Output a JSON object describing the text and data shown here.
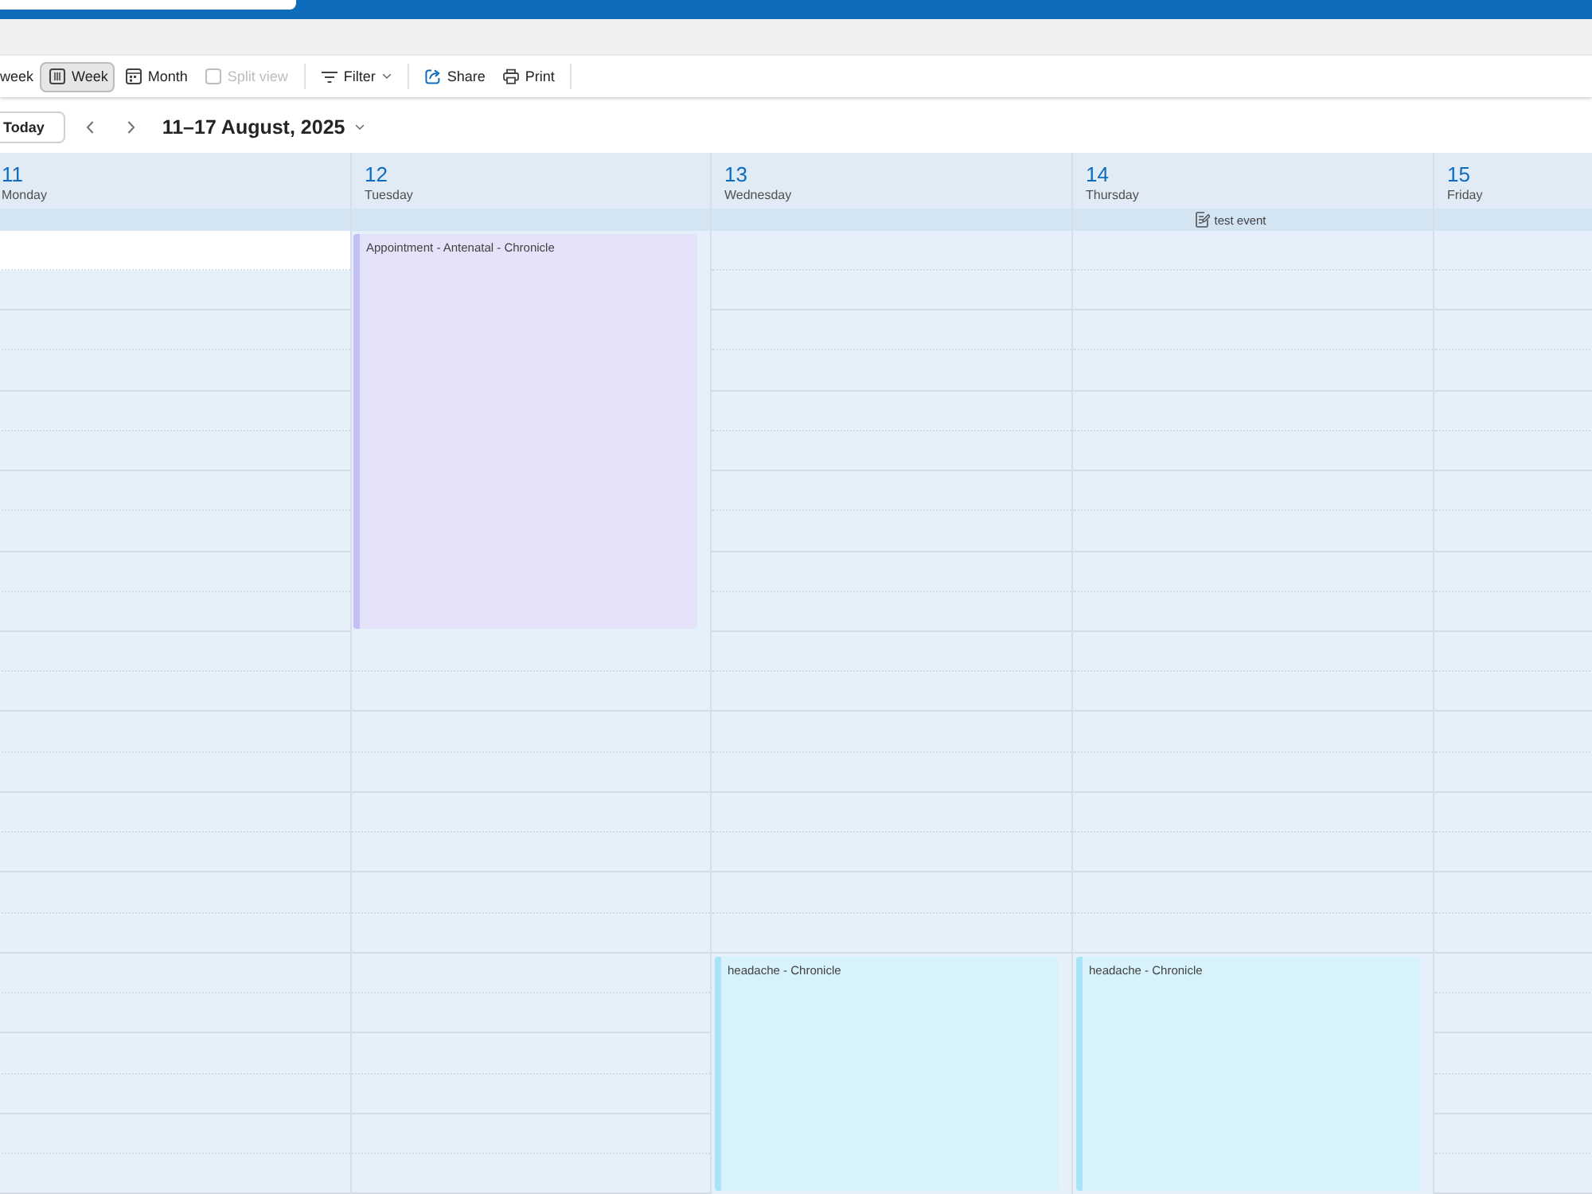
{
  "toolbar": {
    "views": [
      {
        "kind": "label_only",
        "label": "week",
        "selected": false,
        "disabled": false
      },
      {
        "kind": "week",
        "label": "Week",
        "selected": true,
        "disabled": false
      },
      {
        "kind": "month",
        "label": "Month",
        "selected": false,
        "disabled": false
      },
      {
        "kind": "split",
        "label": "Split view",
        "selected": false,
        "disabled": true
      }
    ],
    "actions": [
      {
        "kind": "filter",
        "label": "Filter"
      },
      {
        "kind": "share",
        "label": "Share"
      },
      {
        "kind": "print",
        "label": "Print"
      }
    ]
  },
  "navigation": {
    "today": "Today",
    "range": "11–17 August, 2025"
  },
  "days": [
    {
      "number": "11",
      "name": "Monday",
      "top_slot_selected": true
    },
    {
      "number": "12",
      "name": "Tuesday",
      "events": [
        {
          "title": "Appointment - Antenatal - Chronicle",
          "color": "#c5c0f4"
        }
      ]
    },
    {
      "number": "13",
      "name": "Wednesday",
      "top_slot_selected": false,
      "events": [
        {
          "title": "headache - Chronicle",
          "color": "#a8e3f8"
        }
      ]
    },
    {
      "number": "14",
      "name": "Thursday",
      "top_slot_selected": false,
      "all_day": [
        {
          "title": "test event"
        }
      ],
      "events": [
        {
          "title": "headache - Chronicle",
          "color": "#a8e3f8"
        }
      ]
    },
    {
      "number": "15",
      "name": "Friday",
      "top_slot_selected": false
    }
  ]
}
